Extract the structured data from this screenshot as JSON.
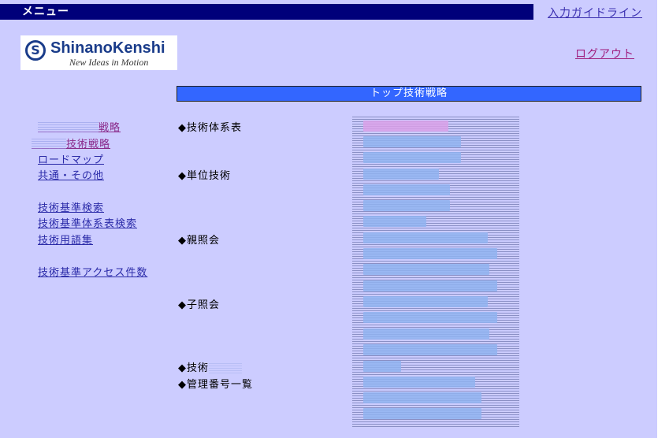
{
  "header": {
    "menu_title": "メニュー",
    "guide_link": "入力ガイドライン",
    "logout_link": "ログアウト"
  },
  "logo": {
    "mark": "S",
    "name": "ShinanoKenshi",
    "tagline": "New Ideas in Motion"
  },
  "section_title": "トップ技術戦略",
  "sidebar": {
    "links": [
      {
        "label": "戦略"
      },
      {
        "label": "技術戦略"
      },
      {
        "label": "ロードマップ"
      },
      {
        "label": "共通・その他"
      },
      {
        "label": "技術基準検索"
      },
      {
        "label": "技術基準体系表検索"
      },
      {
        "label": "技術用語集"
      },
      {
        "label": "技術基準アクセス件数"
      }
    ]
  },
  "categories": [
    {
      "label": "◆技術体系表"
    },
    {
      "label": "◆単位技術"
    },
    {
      "label": "◆親照会"
    },
    {
      "label": "◆子照会"
    },
    {
      "label": "◆技術"
    },
    {
      "label": "◆管理番号一覧"
    }
  ],
  "colors": {
    "menubar": "#00007a",
    "page_bg": "#ccccff",
    "title_bar": "#3366ff",
    "link": "#2a2aa8",
    "visited": "#8a2a8a"
  }
}
